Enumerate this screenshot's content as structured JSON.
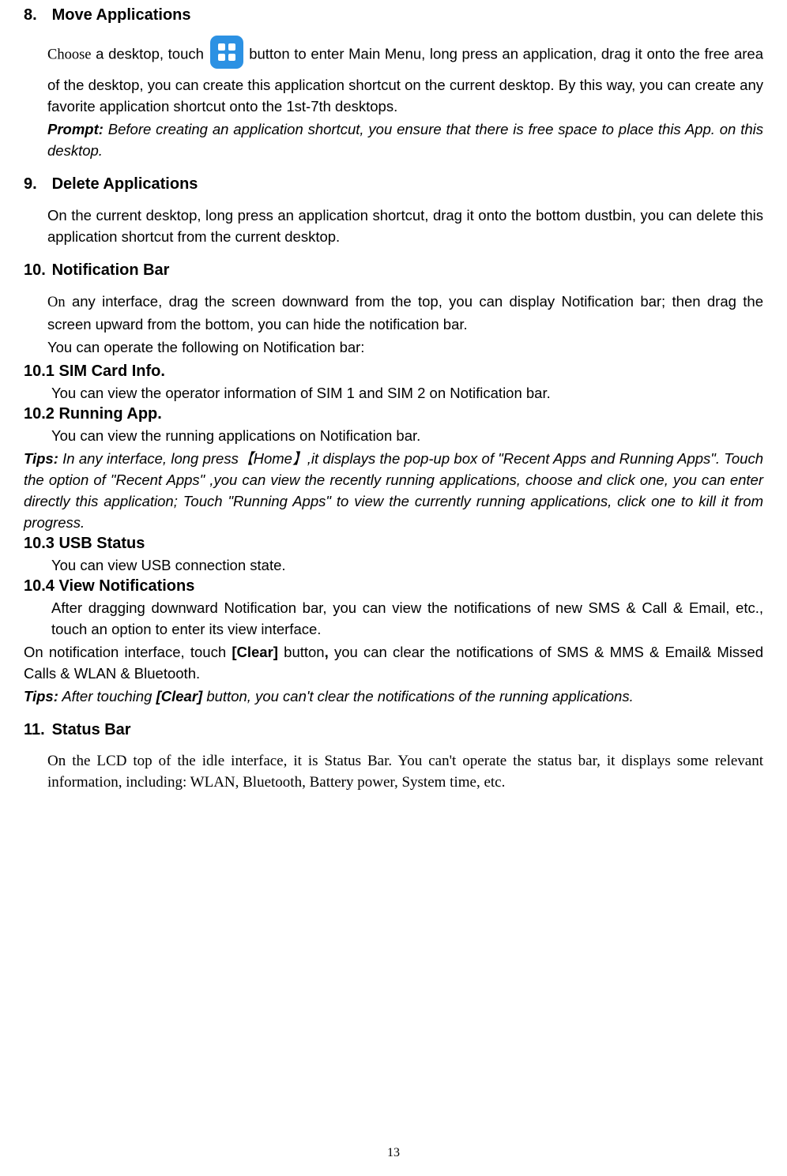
{
  "sections": {
    "s8": {
      "num": "8.",
      "title": "Move Applications",
      "choose": "Choose",
      "p1a": " a desktop, touch ",
      "p1b": " button to enter Main Menu, long press an application, drag it onto the free area of the desktop, you can create this application shortcut on the current desktop. By this way, you can create any favorite application shortcut onto the 1st-7th desktops.",
      "prompt_label": "Prompt:",
      "prompt_body": " Before creating an application shortcut, you ensure that there is free space to place this App. on this desktop."
    },
    "s9": {
      "num": "9.",
      "title": "Delete Applications",
      "p1": "On the current desktop, long press an application shortcut, drag it onto the bottom dustbin, you can delete this application shortcut from the current desktop."
    },
    "s10": {
      "num": "10.",
      "title": "Notification Bar",
      "on": "On",
      "p1": " any interface, drag the screen downward from the top, you can display Notification bar; then drag the screen upward from the bottom, you can hide the notification bar.",
      "p2": "You can operate the following on Notification bar:",
      "sub1_title": "10.1 SIM Card Info.",
      "sub1_body": "You can view the operator information of SIM 1 and SIM 2 on Notification bar.",
      "sub2_title": "10.2 Running App.",
      "sub2_body": "You can view the running applications on Notification bar.",
      "tips_label": "Tips:",
      "sub2_tips": " In any interface, long press【Home】,it displays the pop-up box of \"Recent Apps and Running Apps\". Touch the option of \"Recent Apps\" ,you can view the recently running applications, choose and click one, you can enter directly this application; Touch \"Running Apps\" to view the currently running applications, click one to kill it from progress.",
      "sub3_title": "10.3 USB Status",
      "sub3_body": "You can view USB connection state.",
      "sub4_title": "10.4 View Notifications",
      "sub4_p1": "After dragging downward Notification bar, you can view the notifications of new SMS & Call & Email, etc., touch an option to enter its view interface.",
      "sub4_p2a": "On notification interface, touch ",
      "sub4_clear": "[Clear]",
      "sub4_p2b": " button",
      "sub4_comma": ",",
      "sub4_p2c": " you can clear the notifications of SMS & MMS & Email& Missed Calls & WLAN & Bluetooth.",
      "sub4_tips_a": " After touching ",
      "sub4_tips_clear": "[Clear]",
      "sub4_tips_b": " button, you can't clear the notifications of the running applications."
    },
    "s11": {
      "num": "11.",
      "title": "Status Bar",
      "p1": "On the LCD top of the idle interface, it is Status Bar. You can't operate the status bar, it displays some relevant information, including: WLAN, Bluetooth, Battery power, System time, etc."
    }
  },
  "icon_name": "app-menu-icon",
  "page_number": "13"
}
